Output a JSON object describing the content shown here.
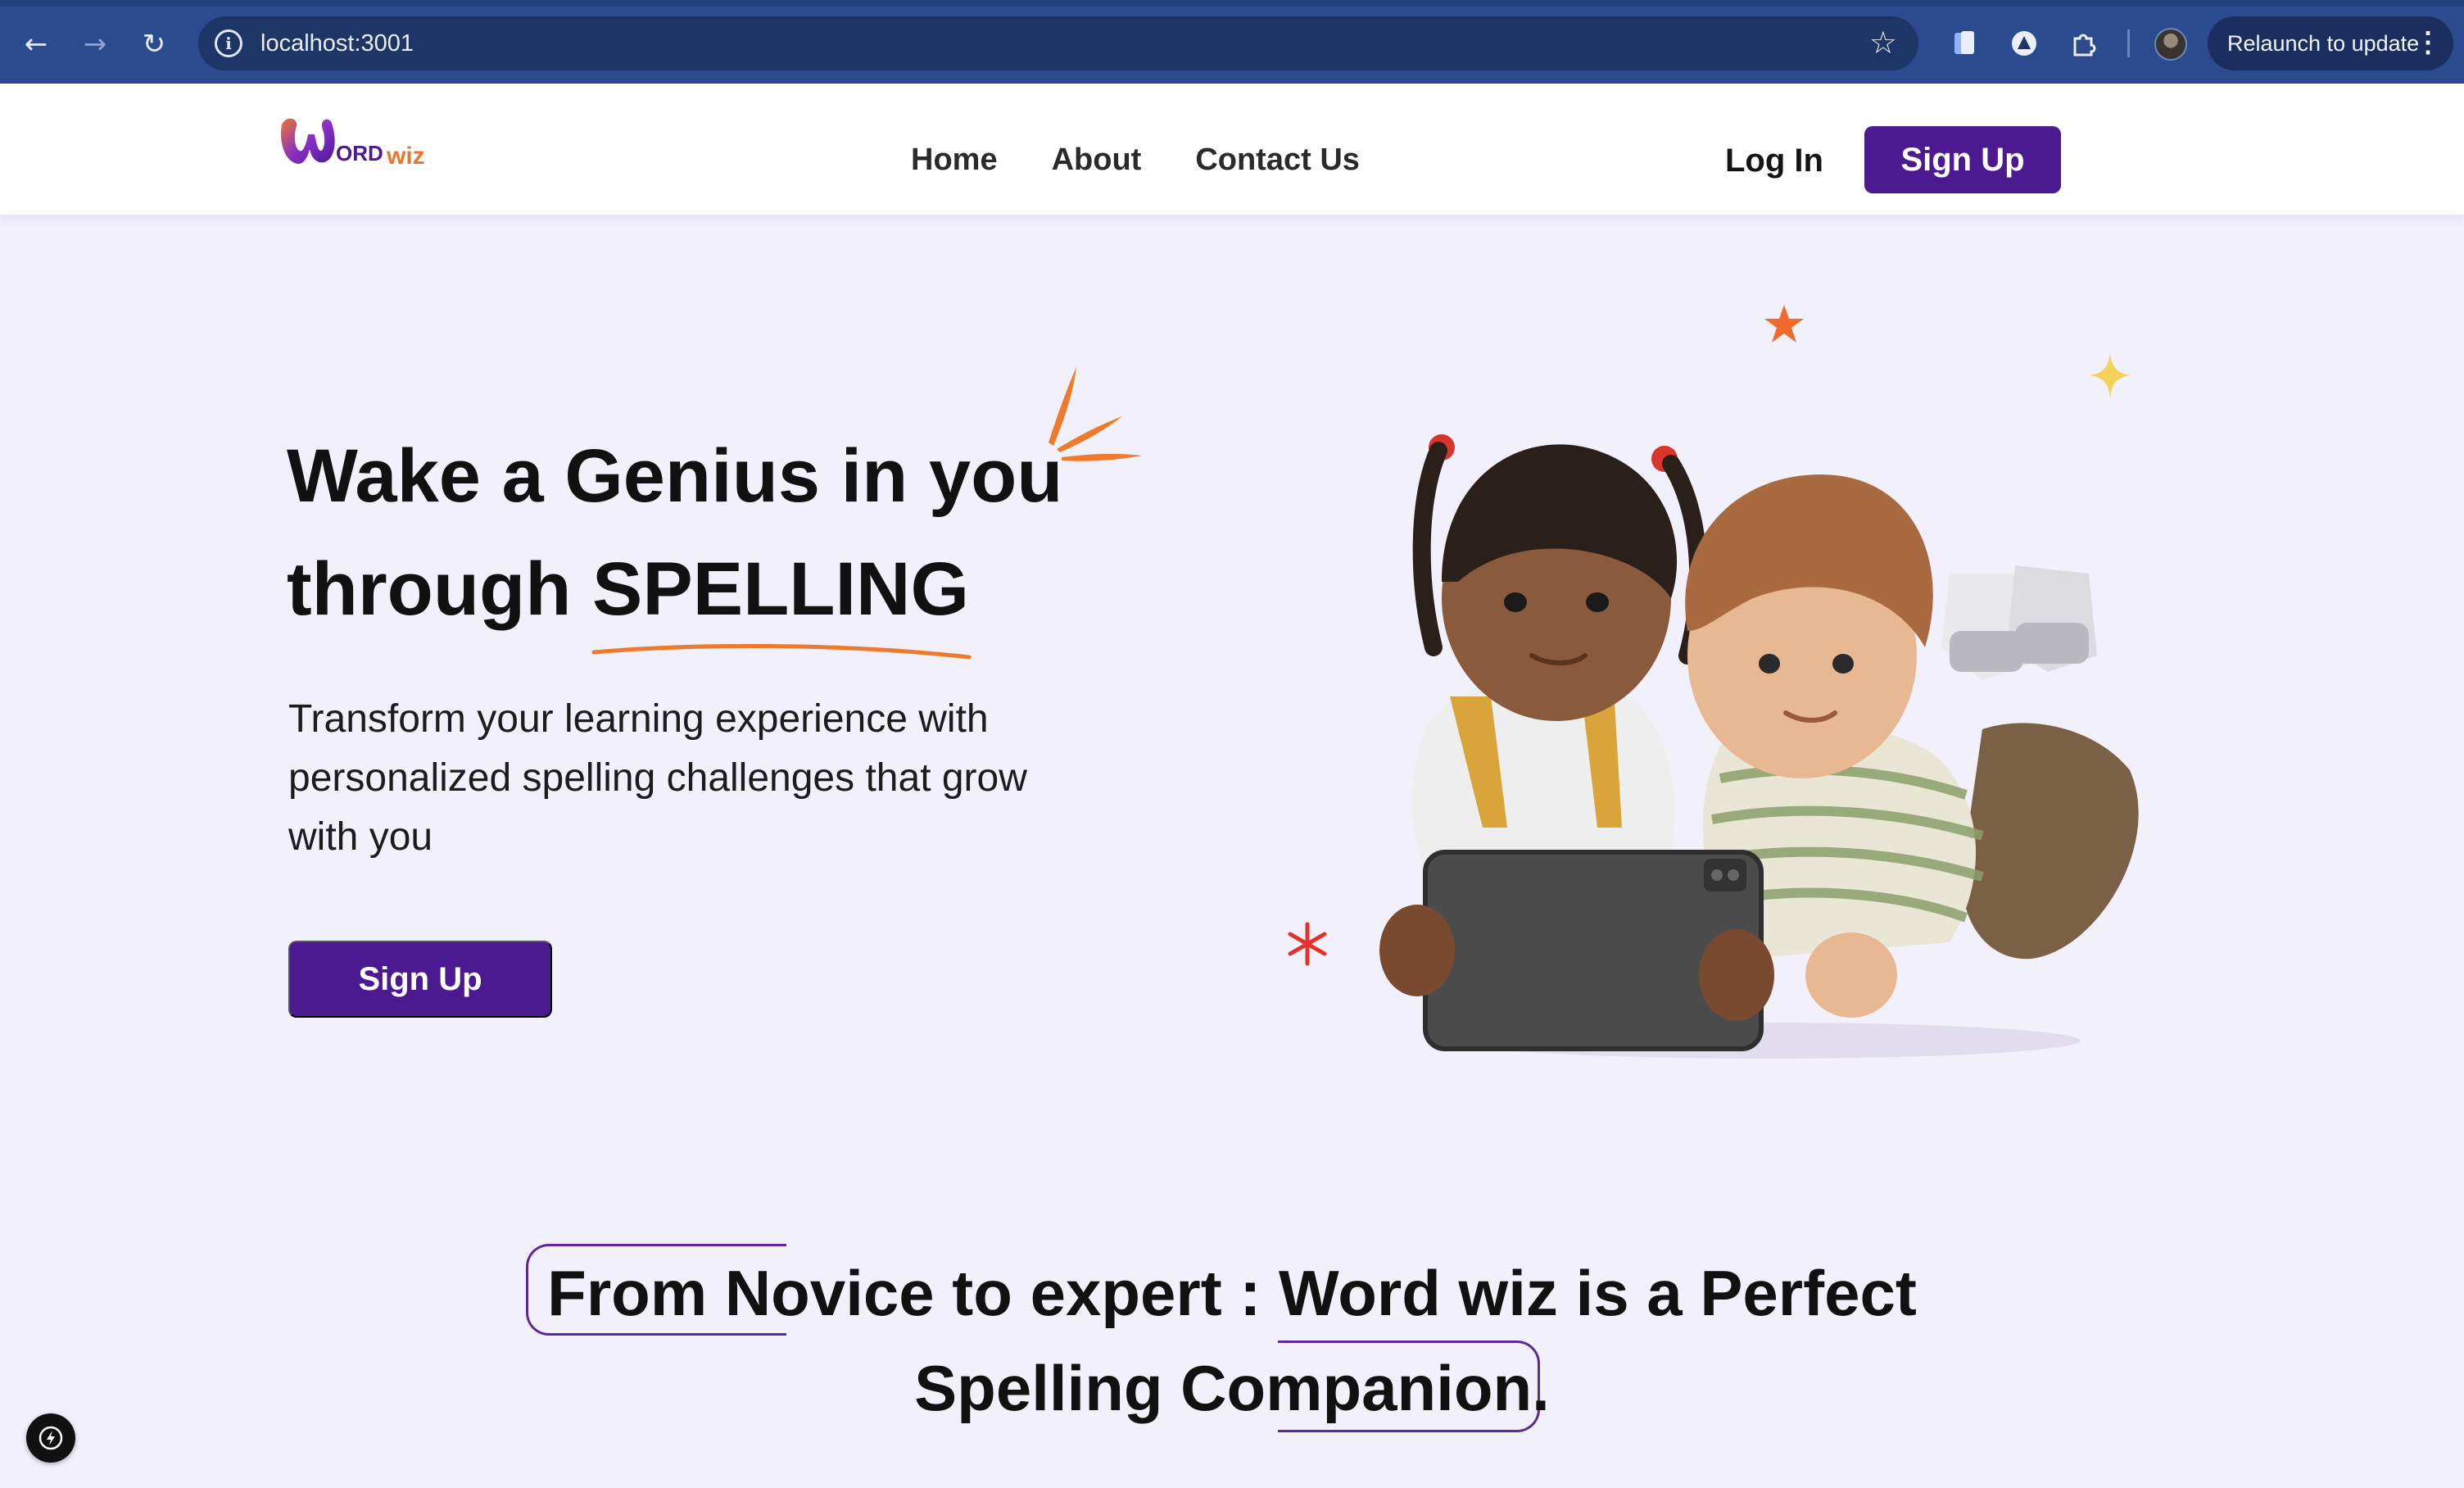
{
  "browser": {
    "url": "localhost:3001",
    "relaunch_label": "Relaunch to update",
    "back_icon": "←",
    "forward_icon": "→",
    "reload_icon": "↻",
    "bookmark_icon": "☆",
    "menu_icon": "⋮"
  },
  "header": {
    "logo_alt": "Wordwiz",
    "nav": [
      {
        "label": "Home"
      },
      {
        "label": "About"
      },
      {
        "label": "Contact Us"
      }
    ],
    "login_label": "Log In",
    "signup_label": "Sign Up"
  },
  "hero": {
    "title_line1": "Wake a Genius in you",
    "title_line2_prefix": "through ",
    "title_accent": "SPELLING",
    "subtitle": "Transform your learning experience with personalized spelling challenges that grow with you",
    "cta_label": "Sign Up"
  },
  "section": {
    "heading_line1": "From Novice to expert : Word wiz is a Perfect",
    "heading_line2": "Spelling Companion."
  },
  "colors": {
    "brand_purple": "#4b1a91",
    "accent_orange": "#ef7a2b",
    "background": "#f2f0fb",
    "chrome_blue": "#2c4a8e"
  }
}
